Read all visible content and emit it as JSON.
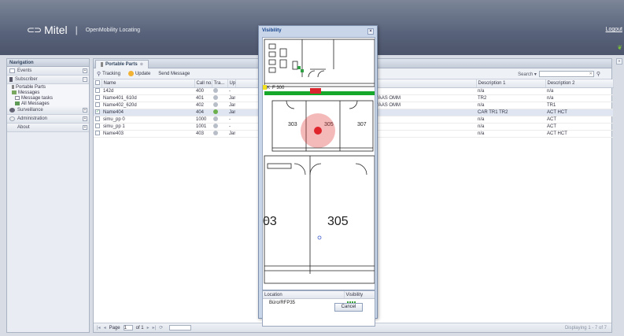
{
  "header": {
    "logo_mark": "⊂⊃",
    "logo_text": "Mitel",
    "separator": "|",
    "app_name": "OpenMobility Locating",
    "logout": "Logout"
  },
  "nav": {
    "title": "Navigation",
    "sections": [
      {
        "label": "Events",
        "toggle": "+"
      },
      {
        "label": "Subscriber",
        "toggle": "−"
      }
    ],
    "subscriber_items": [
      {
        "label": "Portable Parts"
      },
      {
        "label": "Messages"
      },
      {
        "label": "Message tasks"
      },
      {
        "label": "All Messages"
      }
    ],
    "sections_after": [
      {
        "label": "Surveillance",
        "toggle": "+"
      },
      {
        "label": "Administration",
        "toggle": "+"
      },
      {
        "label": "About",
        "toggle": "+"
      }
    ]
  },
  "grid": {
    "tab": "Portable Parts",
    "tab_close": "⊗",
    "toolbar": {
      "tracking": "Tracking",
      "update": "Update",
      "send_message": "Send Message"
    },
    "search_label": "Search ▾",
    "columns": [
      "Name",
      "Call no.",
      "Tra...",
      "Up",
      "",
      "Description 1",
      "Description 2"
    ],
    "rows": [
      {
        "name": "142d",
        "call": "400",
        "tra": "off",
        "up": "-",
        "loc": "",
        "d1": "n/a",
        "d2": "n/a",
        "checked": false
      },
      {
        "name": "Name401_610d",
        "call": "401",
        "tra": "off",
        "up": "Jar",
        "loc": "floor 4/r 444/AAS OMM",
        "d1": "TR2",
        "d2": "n/a",
        "checked": false
      },
      {
        "name": "Name402_620d",
        "call": "402",
        "tra": "off",
        "up": "Jar",
        "loc": "floor 4/r 444/AAS OMM",
        "d1": "n/a",
        "d2": "TR1",
        "checked": false
      },
      {
        "name": "Name404",
        "call": "404",
        "tra": "on",
        "up": "Jar",
        "loc": "",
        "d1": "CAR TR1 TR2",
        "d2": "ACT HCT",
        "checked": true
      },
      {
        "name": "simu_pp 0",
        "call": "1000",
        "tra": "off",
        "up": "-",
        "loc": "",
        "d1": "n/a",
        "d2": "ACT",
        "checked": false
      },
      {
        "name": "simu_pp 1",
        "call": "1001",
        "tra": "off",
        "up": "-",
        "loc": "",
        "d1": "n/a",
        "d2": "ACT",
        "checked": false
      },
      {
        "name": "Name403",
        "call": "403",
        "tra": "off",
        "up": "Jar",
        "loc": "",
        "d1": "n/a",
        "d2": "ACT HCT",
        "checked": false
      }
    ],
    "pager": {
      "page_label": "Page",
      "page_value": "1",
      "of_label": "of 1",
      "displaying": "Displaying 1 - 7 of 7"
    }
  },
  "modal": {
    "title": "Visibility",
    "close": "×",
    "map_labels": {
      "room_f300": "F 300",
      "room_303": "303",
      "room_305": "305",
      "room_307": "307",
      "big_303": "03",
      "big_305": "305",
      "tag_k": "K"
    },
    "location_header": "Location",
    "visibility_header": "Visibility",
    "location_row": "Büro/RFP35",
    "visibility_level": 4,
    "cancel": "Cancel"
  },
  "colors": {
    "header": "#58627a",
    "accent": "#15428b",
    "green": "#3da33a",
    "red_marker": "#e0242c"
  }
}
